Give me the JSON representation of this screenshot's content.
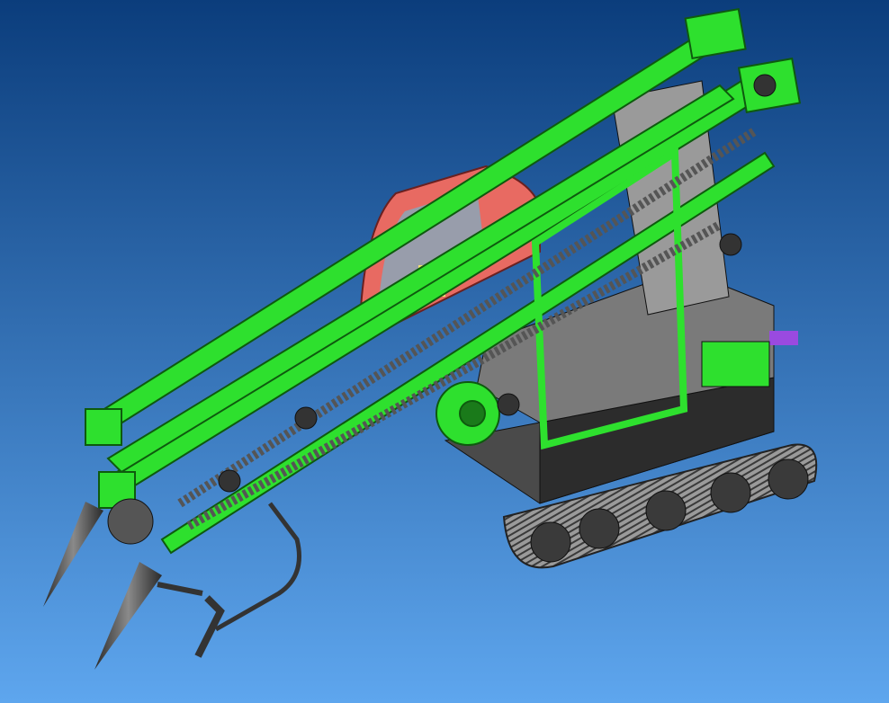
{
  "colors": {
    "background_top": "#0b3d7c",
    "background_bottom": "#5ea6ee",
    "frame_green": "#2ee02e",
    "frame_green_dark": "#128a12",
    "cab_red": "#e86a62",
    "body_gray": "#5a5a5a",
    "body_dark": "#2a2a2a",
    "track_gray": "#8a8a8a",
    "seat_yellow": "#f2e070",
    "knob_purple": "#9a4ae0",
    "beacon_orange": "#ff8a1a"
  }
}
